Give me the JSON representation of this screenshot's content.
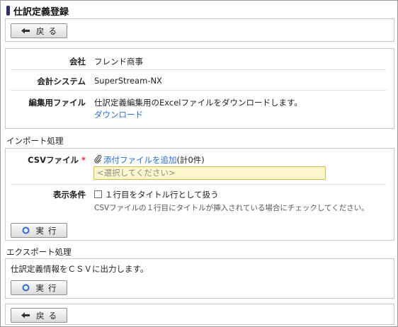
{
  "page": {
    "title": "仕訳定義登録"
  },
  "buttons": {
    "back": "戻る",
    "execute": "実行"
  },
  "info": {
    "company_label": "会社",
    "company_value": "フレンド商事",
    "system_label": "会計システム",
    "system_value": "SuperStream-NX",
    "edit_file_label": "編集用ファイル",
    "edit_file_text": "仕訳定義編集用のExcelファイルをダウンロードします。",
    "download_link": "ダウンロード"
  },
  "import": {
    "section_title": "インポート処理",
    "csv_label": "CSVファイル",
    "required_mark": "*",
    "add_file_link": "添付ファイルを追加",
    "file_count": "(計0件)",
    "select_placeholder": "<選択してください>",
    "display_label": "表示条件",
    "checkbox_label": "１行目をタイトル行として扱う",
    "checkbox_checked": false,
    "checkbox_note": "CSVファイルの１行目にタイトルが挿入されている場合にチェックしてください。"
  },
  "export": {
    "section_title": "エクスポート処理",
    "description": "仕訳定義情報をＣＳＶに出力します。"
  },
  "colors": {
    "link": "#2a6bd0",
    "required": "#e0302a",
    "select_bg": "#fff7cc",
    "title_marker": "#2d2d6e"
  }
}
